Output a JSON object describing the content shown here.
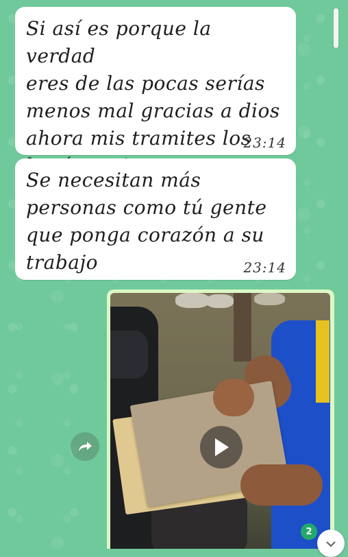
{
  "messages": [
    {
      "text": "Si así es porque la verdad\neres de las pocas serías\nmenos mal gracias a dios\nahora mis tramites los\nharé contigo",
      "time": "23:14"
    },
    {
      "text": "Se necesitan más\npersonas como tú gente\nque ponga corazón a su\ntrabajo",
      "time": "23:14"
    }
  ],
  "video_message": {
    "icon": "play-icon",
    "new_count": "2"
  },
  "icons": {
    "forward": "forward-icon",
    "scroll_down": "chevron-down-icon"
  },
  "colors": {
    "wallpaper": "#6fc99a",
    "bubble": "#ffffff",
    "outgoing_bubble": "#dcf8c6",
    "badge": "#25a96a"
  }
}
